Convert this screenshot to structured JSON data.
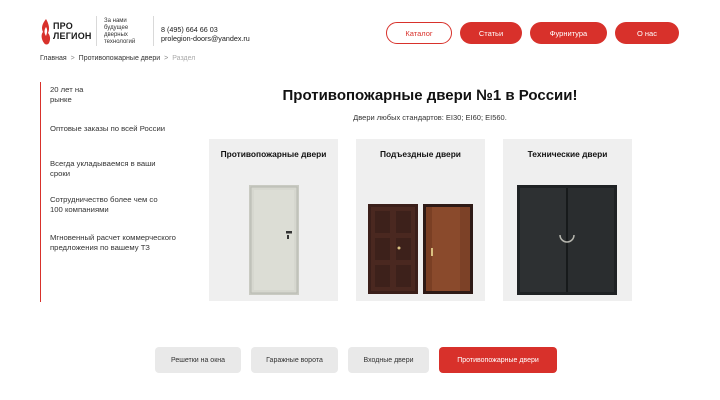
{
  "header": {
    "logo_line1": "ПРО",
    "logo_line2": "ЛЕГИОН",
    "tagline": "За нами будущее дверных технологий",
    "phone": "8 (495) 664 66 03",
    "email": "prolegion-doors@yandex.ru",
    "nav": [
      {
        "label": "Каталог",
        "style": "outline"
      },
      {
        "label": "Статьи",
        "style": "filled"
      },
      {
        "label": "Фурнитура",
        "style": "filled"
      },
      {
        "label": "О нас",
        "style": "filled"
      }
    ]
  },
  "breadcrumb": {
    "home": "Главная",
    "section": "Противопожарные двери",
    "current": "Раздел"
  },
  "side_list": [
    "20 лет на рынке",
    "Оптовые заказы по всей России",
    "Всегда укладываемся в ваши сроки",
    "Сотрудничество более чем со 100 компаниями",
    "Мгновенный расчет коммерческого предложения по вашему ТЗ"
  ],
  "main": {
    "title": "Противопожарные двери №1 в России!",
    "subtitle": "Двери любых стандартов: EI30; EI60; EI560."
  },
  "cards": [
    {
      "title": "Противопожарные двери"
    },
    {
      "title": "Подъездные двери"
    },
    {
      "title": "Технические двери"
    }
  ],
  "tags": [
    {
      "label": "Решетки на окна",
      "active": false
    },
    {
      "label": "Гаражные ворота",
      "active": false
    },
    {
      "label": "Входные двери",
      "active": false
    },
    {
      "label": "Противопожарные двери",
      "active": true
    }
  ],
  "colors": {
    "accent": "#d8312b",
    "card_bg": "#efefef",
    "tag_bg": "#e9e9e9"
  }
}
